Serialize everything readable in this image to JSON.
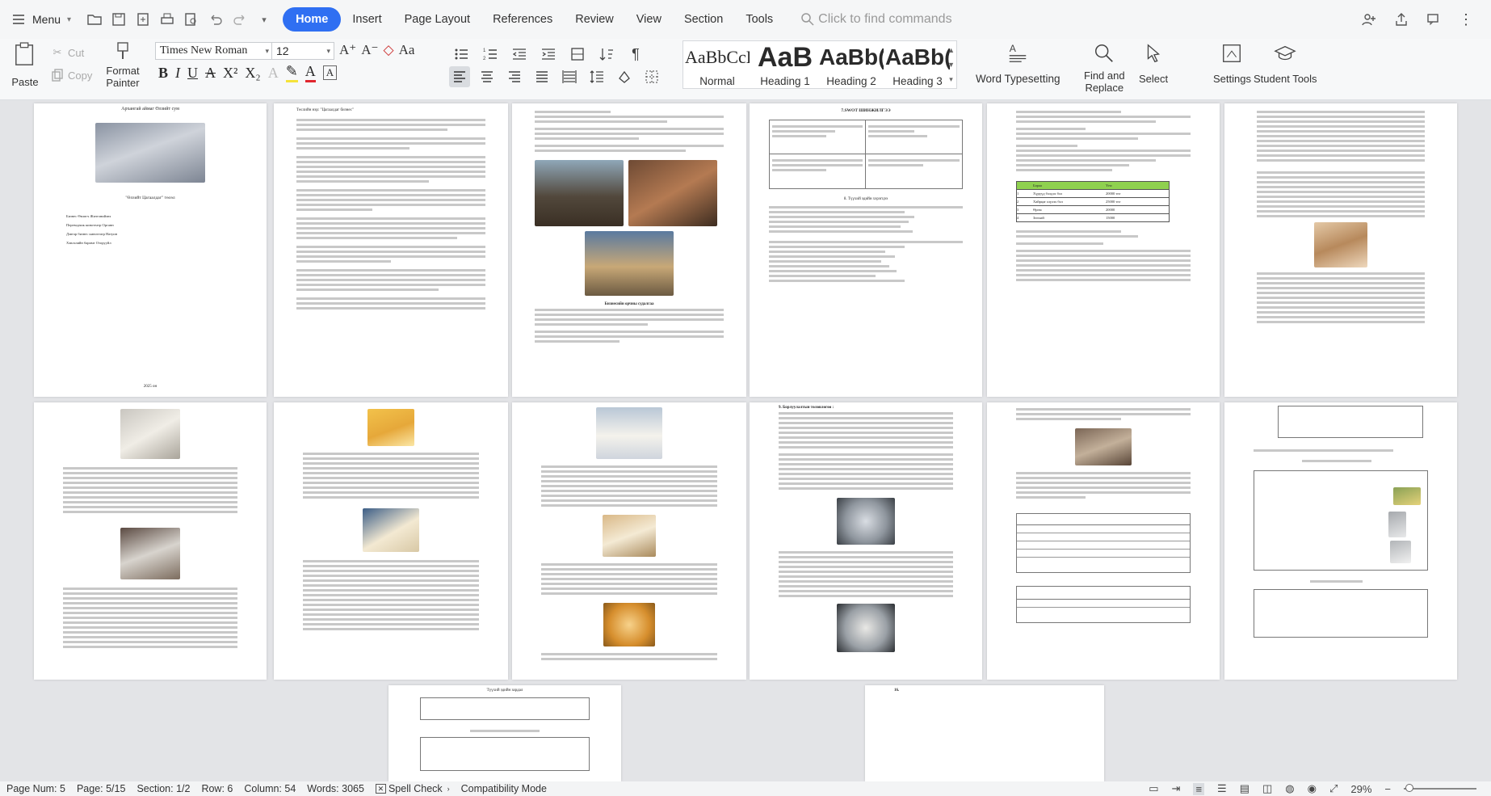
{
  "menubar": {
    "menu_label": "Menu",
    "tabs": [
      "Home",
      "Insert",
      "Page Layout",
      "References",
      "Review",
      "View",
      "Section",
      "Tools"
    ],
    "active_tab": "Home",
    "search_placeholder": "Click to find commands"
  },
  "ribbon": {
    "paste": "Paste",
    "cut": "Cut",
    "copy": "Copy",
    "format_painter_1": "Format",
    "format_painter_2": "Painter",
    "font_name": "Times New Roman",
    "font_size": "12",
    "styles": [
      {
        "preview": "AaBbCcD",
        "label": "Normal"
      },
      {
        "preview": "AaB",
        "label": "Heading 1"
      },
      {
        "preview": "AaBb(",
        "label": "Heading 2"
      },
      {
        "preview": "AaBb(",
        "label": "Heading 3"
      }
    ],
    "word_typesetting": "Word Typesetting",
    "find_replace_1": "Find and",
    "find_replace_2": "Replace",
    "select": "Select",
    "settings": "Settings",
    "student_tools": "Student Tools"
  },
  "pages": {
    "p1_title": "Архангай аймаг Өлзийт сум",
    "p1_caption": "\"Өлзийт Цагаалдаг\" төсөл",
    "p1_list": [
      "Бизнес Өвлөгч Жэнтэнийэнэ",
      "Переводчик кинотеатр Органн",
      "Дэвтэр бизнес кинотеатр Натуин",
      "Хэвлэлийн баримт Оторууйл"
    ],
    "p1_year": "2025 он",
    "p2_title": "Төслийн нэр: \"Цагаалдаг бизнес\"",
    "p4_title": "7.SWOT ШИНЖИЛГЭЭ",
    "p4_mid": "8. Түүхий эдийн хэрэгцээ",
    "p4_bottom": "9. Борлуулалтын төлөвлөгөө :",
    "p3_sub": "Бизнесийн орчны судалгаа",
    "p5_table_header": [
      "Бараа",
      "Үнэ"
    ],
    "p5_rows": [
      [
        "1",
        "Хүрүүд бэлдэх бэл",
        "20000 төг"
      ],
      [
        "2",
        "Хайрцаг шүлэх бэл",
        "25000 төг"
      ],
      [
        "3",
        "Өрөм",
        "20000"
      ],
      [
        "4",
        "Зөөхий",
        "15000"
      ]
    ],
    "p10_bottom_title": "Түүхий эдийн зардал",
    "p14_page_num": "16."
  },
  "status": {
    "page_num": "Page Num: 5",
    "page": "Page: 5/15",
    "section": "Section: 1/2",
    "row": "Row: 6",
    "column": "Column: 54",
    "words": "Words: 3065",
    "spell_check": "Spell Check",
    "compat": "Compatibility Mode",
    "zoom": "29%"
  }
}
